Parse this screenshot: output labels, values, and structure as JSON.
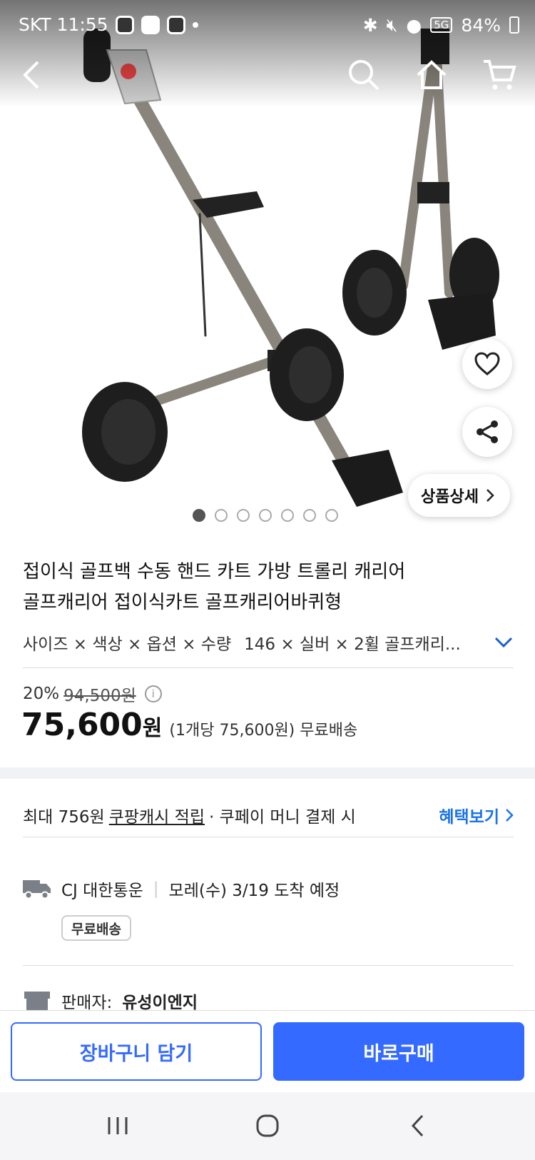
{
  "status_bar": {
    "carrier_time": "SKT 11:55",
    "network": "5G",
    "battery": "84%"
  },
  "gallery": {
    "total": 7,
    "active_index": 0,
    "detail_button": "상품상세"
  },
  "product": {
    "title_line1": "접이식 골프백 수동 핸드 카트 가방 트롤리 캐리어",
    "title_line2": "골프캐리어 접이식카트 골프캐리어바퀴형",
    "option_label": "사이즈 × 색상 × 옵션 × 수량",
    "option_value": "146 × 실버 × 2휠 골프캐리..."
  },
  "price": {
    "discount": "20%",
    "original": "94,500원",
    "current_amount": "75,600",
    "current_unit": "원",
    "per_unit": "(1개당 75,600원) 무료배송"
  },
  "cash": {
    "prefix": "최대 756원",
    "link": "쿠팡캐시 적립",
    "suffix": "· 쿠페이 머니 결제 시",
    "benefit_label": "혜택보기"
  },
  "shipping": {
    "carrier": "CJ 대한통운",
    "eta": "모레(수) 3/19 도착 예정",
    "badge": "무료배송"
  },
  "seller": {
    "label": "판매자:",
    "name": "유성이엔지"
  },
  "actions": {
    "cart": "장바구니 담기",
    "buy": "바로구매"
  },
  "colors": {
    "primary": "#346aff",
    "link": "#1a73e8"
  }
}
